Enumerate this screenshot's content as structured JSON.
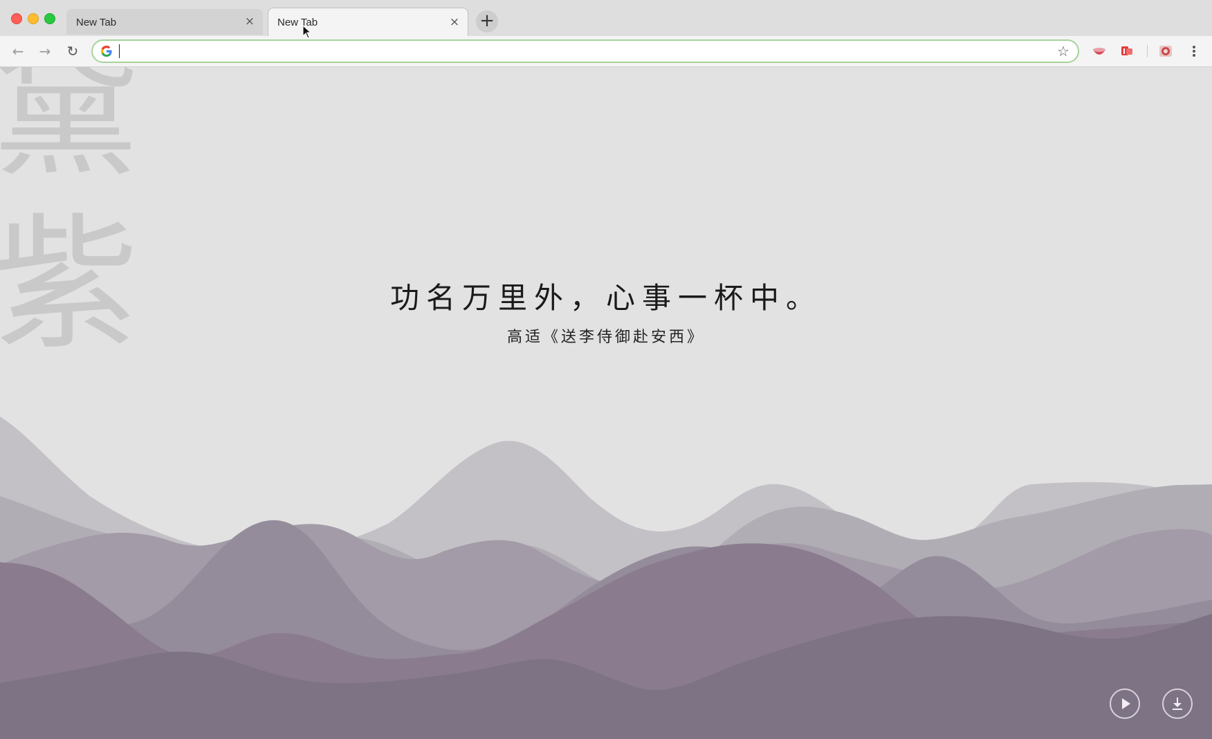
{
  "browser": {
    "tabs": [
      {
        "title": "New Tab",
        "close_label": "×"
      },
      {
        "title": "New Tab",
        "close_label": "×"
      }
    ],
    "new_tab_label": "+",
    "omnibox": {
      "value": ""
    },
    "nav": {
      "back": "←",
      "forward": "→",
      "reload": "↻",
      "bookmark": "☆"
    }
  },
  "page": {
    "watermark": [
      "黛",
      "紫"
    ],
    "quote": "功名万里外，心事一杯中。",
    "attribution": "高适《送李侍御赴安西》"
  },
  "colors": {
    "background": "#e2e2e2",
    "mountain_light": "#c3c1c6",
    "mountain_mid": "#a39ca8",
    "mountain_deep": "#8a7c8e",
    "mountain_darkest": "#7d7385"
  },
  "icons": {
    "play": "play-icon",
    "download": "download-icon"
  }
}
